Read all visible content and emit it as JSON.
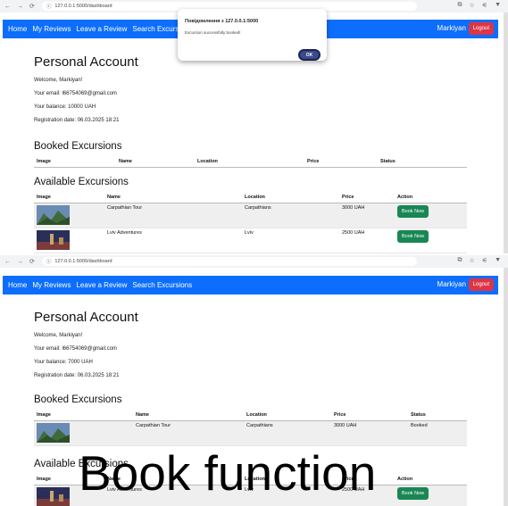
{
  "browser": {
    "url": "127.0.0.1:5000/dashboard",
    "back_icon": "arrow-left",
    "forward_icon": "arrow-right",
    "reload_icon": "reload",
    "info_icon": "info"
  },
  "navbar": {
    "links": [
      "Home",
      "My Reviews",
      "Leave a Review",
      "Search Excursions"
    ],
    "user": "Markiyan",
    "logout": "Logout",
    "colors": {
      "navbar": "#0d6efd",
      "logout": "#dc3545",
      "book": "#198754"
    }
  },
  "dialog": {
    "title": "Повідомлення з 127.0.0.1:5000",
    "message": "Excursion successfully booked!",
    "ok": "OK"
  },
  "account_before": {
    "title": "Personal Account",
    "welcome": "Welcome, Markiyan!",
    "email": "Your email: l66754069@gmail.com",
    "balance": "Your balance: 10000 UAH",
    "registration": "Registration date: 06.03.2025 18:21"
  },
  "account_after": {
    "title": "Personal Account",
    "welcome": "Welcome, Markiyan!",
    "email": "Your email: l66754069@gmail.com",
    "balance": "Your balance: 7000 UAH",
    "registration": "Registration date: 06.03.2025 18:21"
  },
  "booked": {
    "heading": "Booked Excursions",
    "headers": [
      "Image",
      "Name",
      "Location",
      "Price",
      "Status"
    ],
    "rows_after": [
      {
        "name": "Carpathian Tour",
        "location": "Carpathians",
        "price": "3000 UAH",
        "status": "Booked"
      }
    ]
  },
  "available": {
    "heading": "Available Excursions",
    "headers": [
      "Image",
      "Name",
      "Location",
      "Price",
      "Action"
    ],
    "rows": [
      {
        "name": "Carpathian Tour",
        "location": "Carpathians",
        "price": "3000 UAH",
        "action": "Book Now"
      },
      {
        "name": "Lviv Adventures",
        "location": "Lviv",
        "price": "2500 UAH",
        "action": "Book Now"
      }
    ]
  },
  "overlay_caption": "Book function"
}
